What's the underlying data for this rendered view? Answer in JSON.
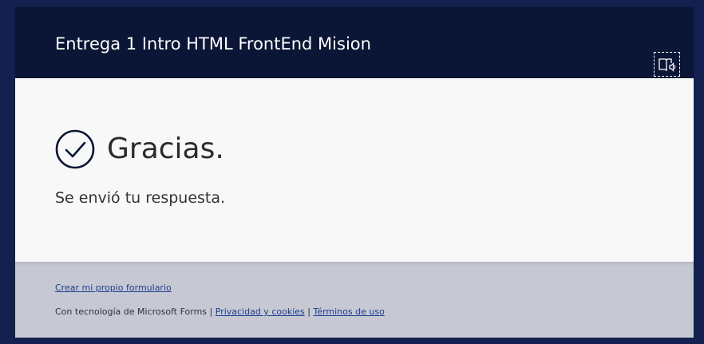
{
  "form": {
    "title": "Entrega 1 Intro HTML FrontEnd Mision",
    "immersive_reader_icon": "immersive-reader-icon"
  },
  "confirmation": {
    "icon": "checkmark-circle-icon",
    "heading": "Gracias.",
    "message": "Se envió tu respuesta."
  },
  "footer": {
    "create_link": "Crear mi propio formulario",
    "powered_by": "Con tecnología de Microsoft Forms",
    "separator": "|",
    "privacy_link": "Privacidad y cookies",
    "terms_link": "Términos de uso"
  },
  "colors": {
    "page_background": "#142150",
    "header_background": "#0b1535",
    "footer_background": "#c6c9d3",
    "link": "#1d3e8c"
  }
}
